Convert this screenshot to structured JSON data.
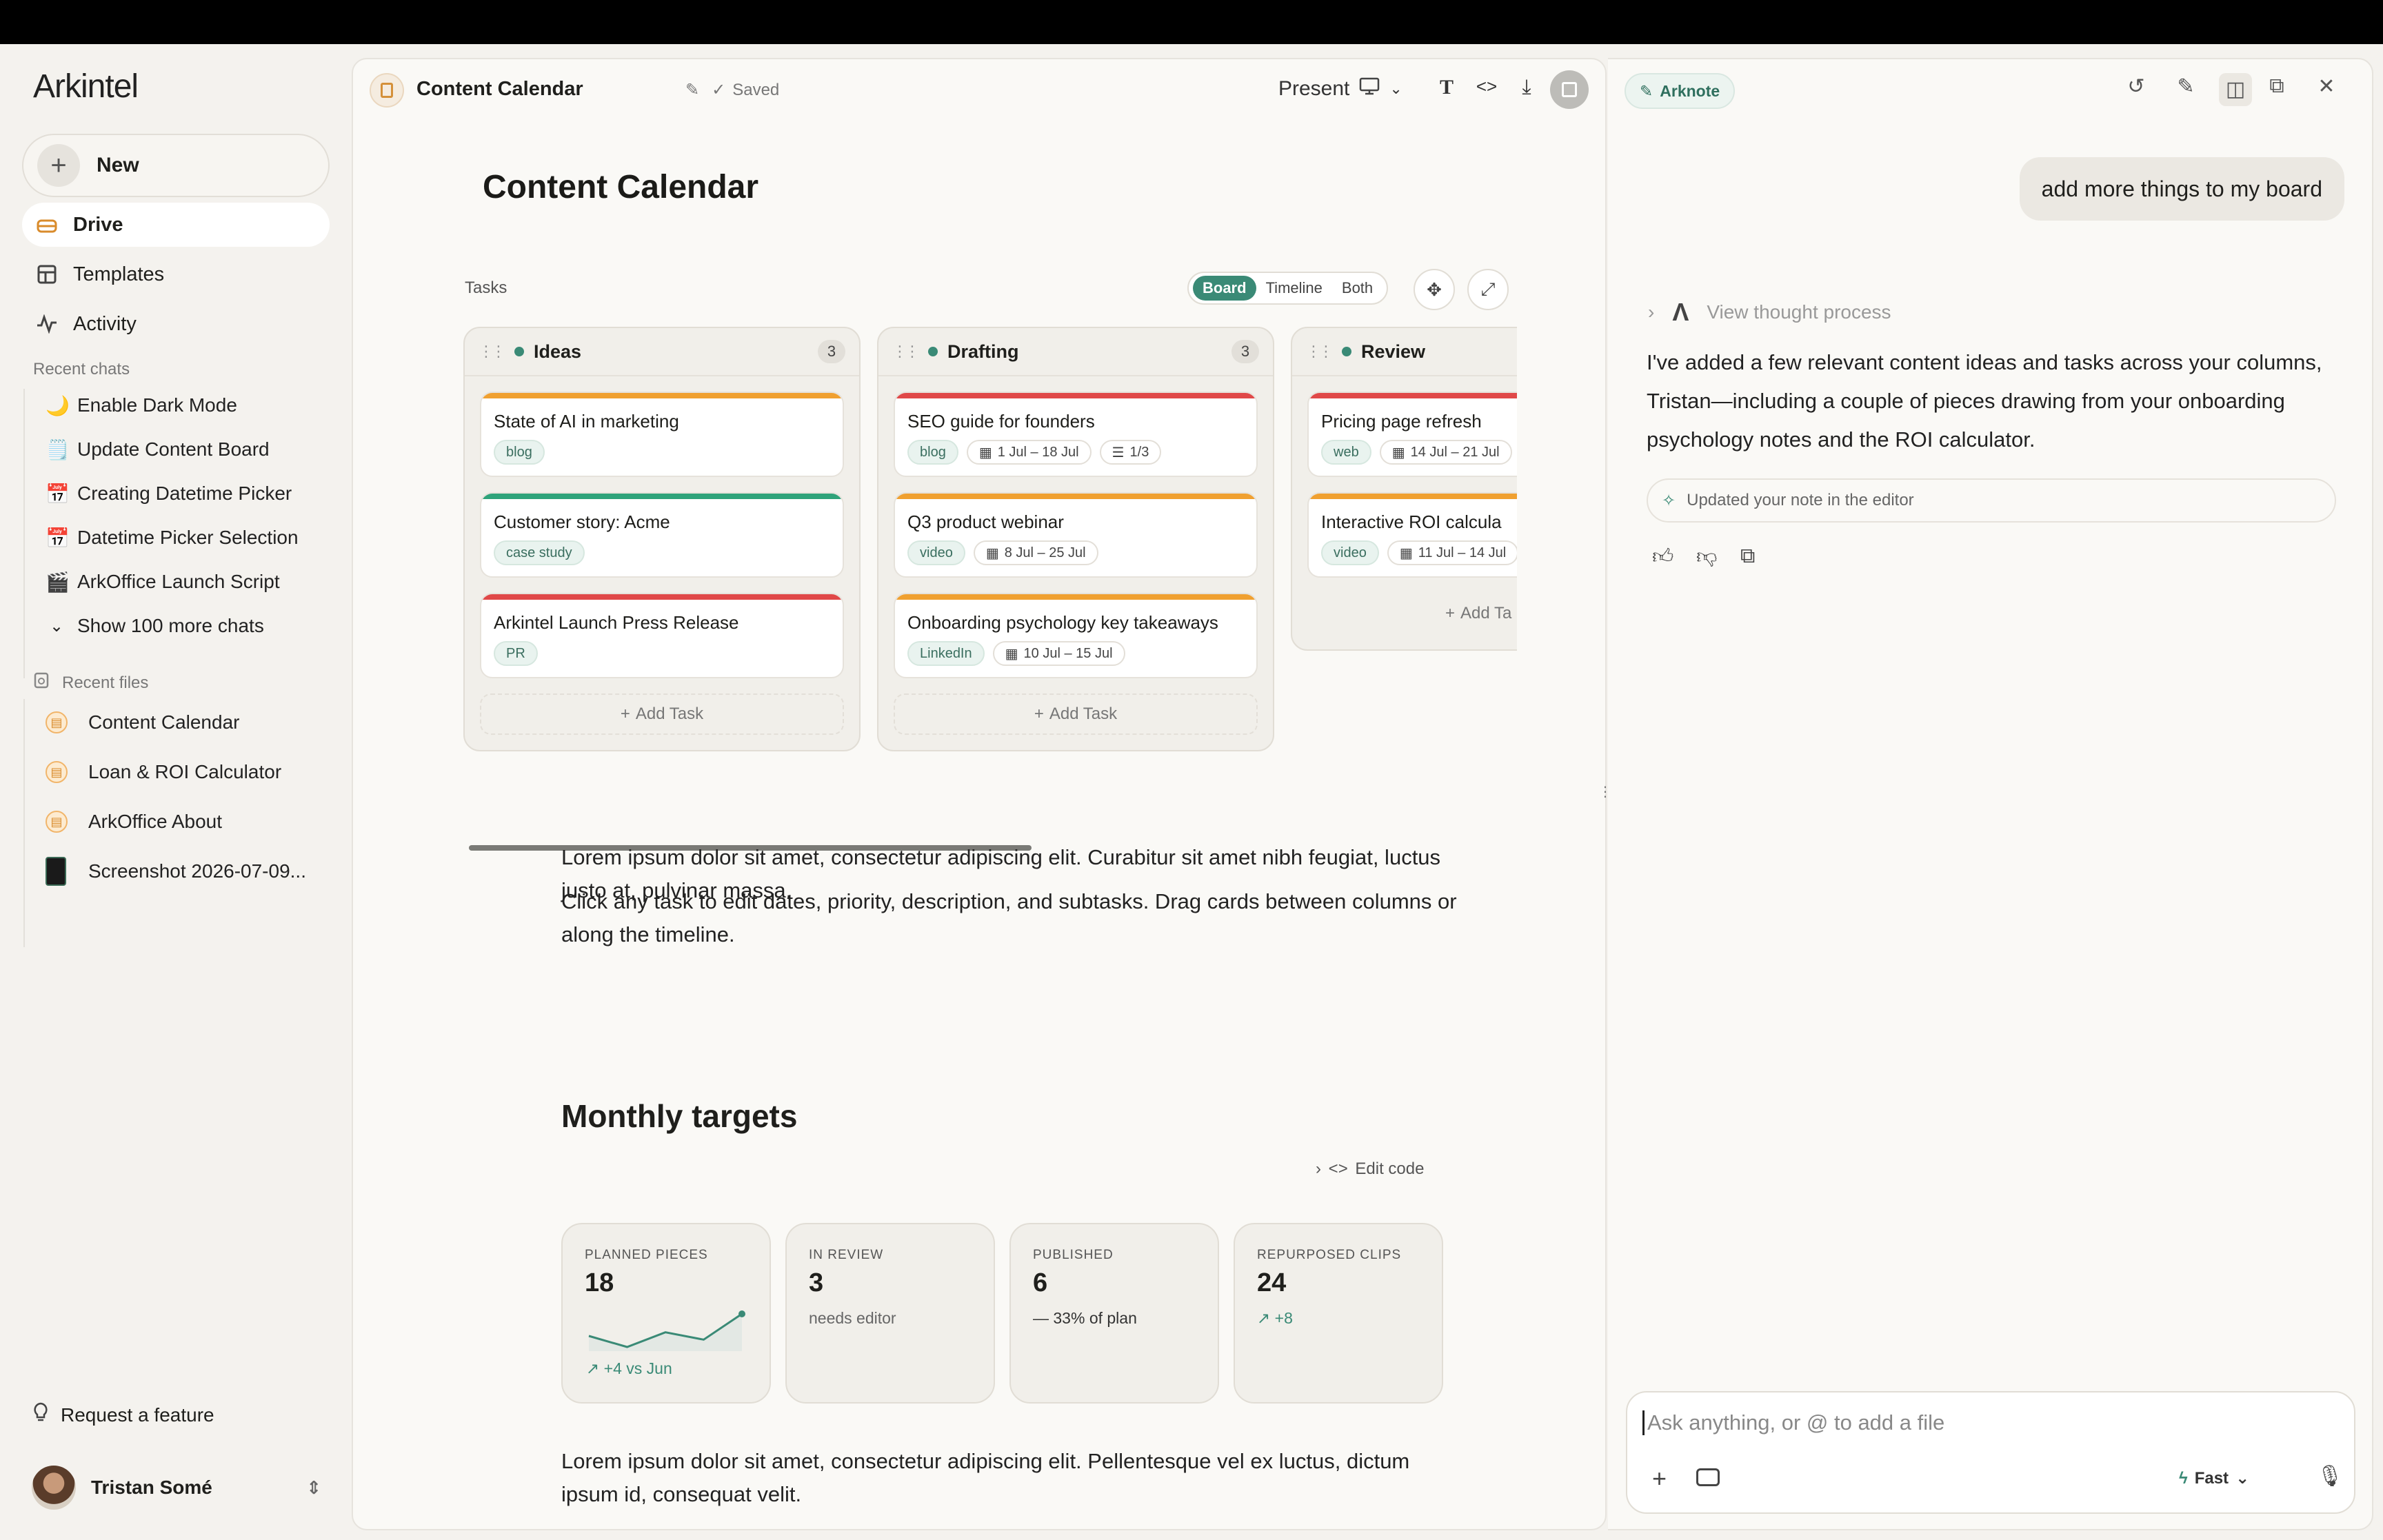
{
  "app": {
    "logo": "Arkintel"
  },
  "sidebar": {
    "new_label": "New",
    "nav": [
      {
        "label": "Drive",
        "icon": "drive-icon"
      },
      {
        "label": "Templates",
        "icon": "templates-icon"
      },
      {
        "label": "Activity",
        "icon": "activity-icon"
      }
    ],
    "recent_chats_label": "Recent chats",
    "recent_chats": [
      {
        "emoji": "🌙",
        "label": "Enable Dark Mode"
      },
      {
        "emoji": "🗒️",
        "label": "Update Content Board"
      },
      {
        "emoji": "📅",
        "label": "Creating Datetime Picker"
      },
      {
        "emoji": "📅",
        "label": "Datetime Picker Selection"
      },
      {
        "emoji": "🎬",
        "label": "ArkOffice Launch Script"
      }
    ],
    "show_more": "Show 100 more chats",
    "recent_files_label": "Recent files",
    "recent_files": [
      {
        "label": "Content Calendar",
        "icon": "document-icon"
      },
      {
        "label": "Loan & ROI Calculator",
        "icon": "document-icon"
      },
      {
        "label": "ArkOffice About",
        "icon": "document-icon"
      },
      {
        "label": "Screenshot 2026-07-09...",
        "icon": "image-file-icon"
      }
    ],
    "request_feature": "Request a feature",
    "user_name": "Tristan Somé"
  },
  "editor": {
    "doc_title": "Content Calendar",
    "saved_label": "Saved",
    "present_label": "Present",
    "page_title": "Content Calendar",
    "tasks_label": "Tasks",
    "view_options": [
      "Board",
      "Timeline",
      "Both"
    ],
    "active_view": "Board",
    "add_task": "Add Task",
    "columns": [
      {
        "name": "Ideas",
        "count": "3",
        "cards": [
          {
            "title": "State of AI in marketing",
            "color": "#f0a030",
            "tags": [
              "blog"
            ]
          },
          {
            "title": "Customer story: Acme",
            "color": "#2fa37a",
            "tags": [
              "case study"
            ]
          },
          {
            "title": "Arkintel Launch Press Release",
            "color": "#e04848",
            "tags": [
              "PR"
            ]
          }
        ]
      },
      {
        "name": "Drafting",
        "count": "3",
        "cards": [
          {
            "title": "SEO guide for founders",
            "color": "#e04848",
            "tags": [
              "blog"
            ],
            "date": "1 Jul – 18 Jul",
            "subtasks": "1/3"
          },
          {
            "title": "Q3 product webinar",
            "color": "#f0a030",
            "tags": [
              "video"
            ],
            "date": "8 Jul – 25 Jul"
          },
          {
            "title": "Onboarding psychology key takeaways",
            "color": "#f0a030",
            "tags": [
              "LinkedIn"
            ],
            "date": "10 Jul – 15 Jul"
          }
        ]
      },
      {
        "name": "Review",
        "count": "",
        "cards": [
          {
            "title": "Pricing page refresh",
            "color": "#e04848",
            "tags": [
              "web"
            ],
            "date": "14 Jul – 21 Jul"
          },
          {
            "title": "Interactive ROI calcula",
            "color": "#f0a030",
            "tags": [
              "video"
            ],
            "date": "11 Jul – 14 Jul"
          }
        ],
        "add_task": "Add Ta"
      }
    ],
    "para1": "Lorem ipsum dolor sit amet, consectetur adipiscing elit. Curabitur sit amet nibh feugiat, luctus justo at, pulvinar massa.",
    "para2": "Click any task to edit dates, priority, description, and subtasks. Drag cards between columns or along the timeline.",
    "h2": "Monthly targets",
    "edit_code": "Edit code",
    "stats": [
      {
        "label": "PLANNED PIECES",
        "value": "18",
        "foot": "↗ +4 vs Jun",
        "spark": [
          3,
          1.5,
          3.5,
          2.5,
          6
        ]
      },
      {
        "label": "IN REVIEW",
        "value": "3",
        "sub": "needs editor"
      },
      {
        "label": "PUBLISHED",
        "value": "6",
        "sub": "— 33% of plan"
      },
      {
        "label": "REPURPOSED CLIPS",
        "value": "24",
        "sub": "↗ +8"
      }
    ],
    "para3": "Lorem ipsum dolor sit amet, consectetur adipiscing elit. Pellentesque vel ex luctus, dictum ipsum id, consequat velit."
  },
  "chat": {
    "badge": "Arknote",
    "user_message": "add more things to my board",
    "thought": "View thought process",
    "reply": "I've added a few relevant content ideas and tasks across your columns, Tristan—including a couple of pieces drawing from your onboarding psychology notes and the ROI calculator.",
    "updated": "Updated your note in the editor",
    "placeholder": "Ask anything, or @ to add a file",
    "mode": "Fast"
  },
  "colors": {
    "accent": "#3a8a76",
    "orange": "#f0a030",
    "red": "#e04848",
    "green": "#2fa37a"
  }
}
